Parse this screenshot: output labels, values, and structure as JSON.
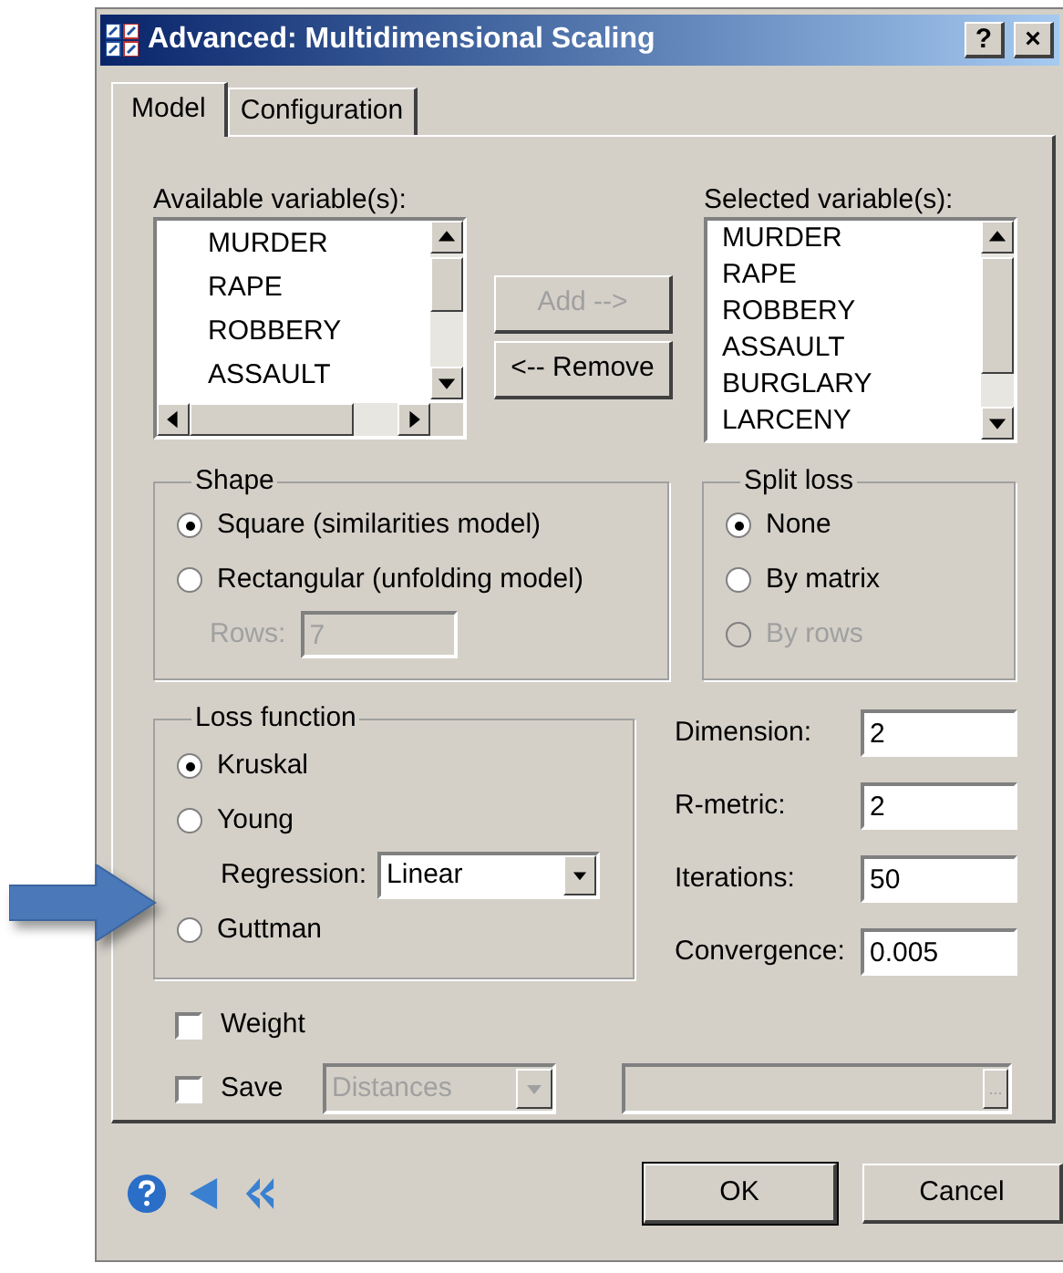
{
  "window": {
    "title": "Advanced: Multidimensional Scaling",
    "title_buttons": [
      "?",
      "×"
    ]
  },
  "tabs": [
    {
      "label": "Model",
      "selected": true
    },
    {
      "label": "Configuration",
      "selected": false
    }
  ],
  "available": {
    "label": "Available variable(s):",
    "items": [
      "MURDER",
      "RAPE",
      "ROBBERY",
      "ASSAULT"
    ]
  },
  "transfer_buttons": [
    {
      "label": "Add -->",
      "disabled": true
    },
    {
      "label": "<-- Remove",
      "disabled": false
    }
  ],
  "selected_variables": {
    "label": "Selected variable(s):",
    "items": [
      "MURDER",
      "RAPE",
      "ROBBERY",
      "ASSAULT",
      "BURGLARY",
      "LARCENY"
    ]
  },
  "shape": {
    "title": "Shape",
    "options": [
      {
        "label": "Square (similarities model)",
        "selected": true,
        "disabled": false
      },
      {
        "label": "Rectangular (unfolding model)",
        "selected": false,
        "disabled": false
      }
    ],
    "rows": {
      "label": "Rows:",
      "value": "7",
      "disabled": true
    }
  },
  "split_loss": {
    "title": "Split loss",
    "options": [
      {
        "label": "None",
        "selected": true,
        "disabled": false
      },
      {
        "label": "By matrix",
        "selected": false,
        "disabled": false
      },
      {
        "label": "By rows",
        "selected": false,
        "disabled": true
      }
    ]
  },
  "loss_function": {
    "title": "Loss function",
    "options": [
      {
        "label": "Kruskal",
        "selected": true
      },
      {
        "label": "Young",
        "selected": false
      },
      {
        "label": "Guttman",
        "selected": false
      }
    ],
    "regression": {
      "label": "Regression:",
      "value": "Linear"
    }
  },
  "parameters": [
    {
      "label": "Dimension:",
      "value": "2"
    },
    {
      "label": "R-metric:",
      "value": "2"
    },
    {
      "label": "Iterations:",
      "value": "50"
    },
    {
      "label": "Convergence:",
      "value": "0.005"
    }
  ],
  "weight": {
    "label": "Weight",
    "checked": false
  },
  "save": {
    "label": "Save",
    "checked": false,
    "combo": {
      "value": "Distances",
      "disabled": true
    },
    "browse": "..."
  },
  "buttons": [
    "OK",
    "Cancel"
  ]
}
